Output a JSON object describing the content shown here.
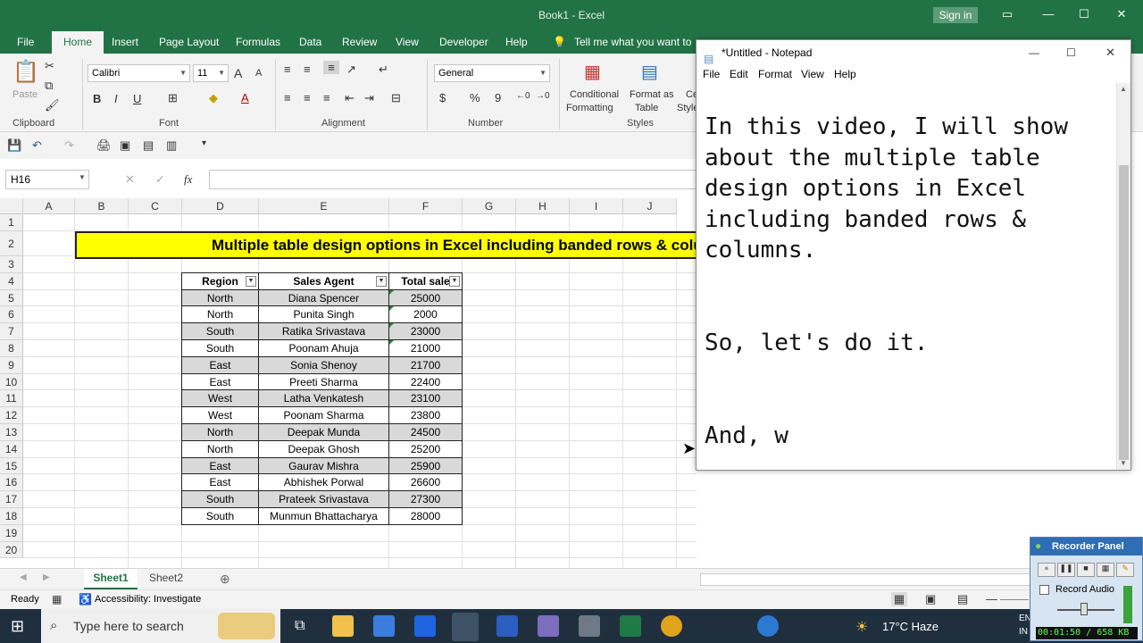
{
  "excel": {
    "window_title": "Book1  -  Excel",
    "sign_in": "Sign in",
    "ribbon_tabs": [
      "File",
      "Home",
      "Insert",
      "Page Layout",
      "Formulas",
      "Data",
      "Review",
      "View",
      "Developer",
      "Help"
    ],
    "tell_me": "Tell me what you want to do",
    "clipboard": {
      "paste": "Paste",
      "group": "Clipboard"
    },
    "font": {
      "name": "Calibri",
      "size": "11",
      "bold": "B",
      "italic": "I",
      "underline": "U",
      "group": "Font",
      "grow": "A",
      "shrink": "A"
    },
    "alignment": {
      "group": "Alignment"
    },
    "number": {
      "format": "General",
      "group": "Number",
      "currency": "$",
      "percent": "%",
      "comma": "9"
    },
    "styles": {
      "conditional": [
        "Conditional",
        "Formatting"
      ],
      "format_table": [
        "Format as",
        "Table"
      ],
      "cell": [
        "Ce",
        "Style"
      ],
      "group": "Styles"
    },
    "name_box": "H16",
    "fx": "fx",
    "columns": [
      {
        "label": "A",
        "w": 58
      },
      {
        "label": "B",
        "w": 60
      },
      {
        "label": "C",
        "w": 60
      },
      {
        "label": "D",
        "w": 86
      },
      {
        "label": "E",
        "w": 146
      },
      {
        "label": "F",
        "w": 82
      },
      {
        "label": "G",
        "w": 60
      },
      {
        "label": "H",
        "w": 60
      },
      {
        "label": "I",
        "w": 60
      },
      {
        "label": "J",
        "w": 60
      }
    ],
    "rows": [
      "1",
      "2",
      "3",
      "4",
      "5",
      "6",
      "7",
      "8",
      "9",
      "10",
      "11",
      "12",
      "13",
      "14",
      "15",
      "16",
      "17",
      "18",
      "19",
      "20"
    ],
    "banner": "Multiple table design options in Excel including banded rows & columns",
    "table": {
      "headers": [
        "Region",
        "Sales Agent",
        "Total sale"
      ],
      "rows": [
        [
          "North",
          "Diana Spencer",
          "25000"
        ],
        [
          "North",
          "Punita Singh",
          "2000"
        ],
        [
          "South",
          "Ratika Srivastava",
          "23000"
        ],
        [
          "South",
          "Poonam Ahuja",
          "21000"
        ],
        [
          "East",
          "Sonia Shenoy",
          "21700"
        ],
        [
          "East",
          "Preeti Sharma",
          "22400"
        ],
        [
          "West",
          "Latha Venkatesh",
          "23100"
        ],
        [
          "West",
          "Poonam Sharma",
          "23800"
        ],
        [
          "North",
          "Deepak Munda",
          "24500"
        ],
        [
          "North",
          "Deepak Ghosh",
          "25200"
        ],
        [
          "East",
          "Gaurav Mishra",
          "25900"
        ],
        [
          "East",
          "Abhishek Porwal",
          "26600"
        ],
        [
          "South",
          "Prateek Srivastava",
          "27300"
        ],
        [
          "South",
          "Munmun Bhattacharya",
          "28000"
        ]
      ]
    },
    "sheets": [
      "Sheet1",
      "Sheet2"
    ],
    "status": {
      "ready": "Ready",
      "accessibility": "Accessibility: Investigate"
    }
  },
  "notepad": {
    "title": "*Untitled - Notepad",
    "menu": [
      "File",
      "Edit",
      "Format",
      "View",
      "Help"
    ],
    "text": "In this video, I will show\nabout the multiple table\ndesign options in Excel\nincluding banded rows &\ncolumns.\n\n\nSo, let's do it.\n\n\nAnd, w"
  },
  "taskbar": {
    "search_placeholder": "Type here to search",
    "weather": "17°C  Haze",
    "lang": [
      "EN",
      "IN"
    ]
  },
  "recorder": {
    "title": "Recorder Panel",
    "record_audio": "Record Audio",
    "timer": "00:01:50 / 658 KB"
  },
  "colors": {
    "excel_green": "#217346",
    "banner_yellow": "#ffff00",
    "band_gray": "#d9d9d9"
  }
}
